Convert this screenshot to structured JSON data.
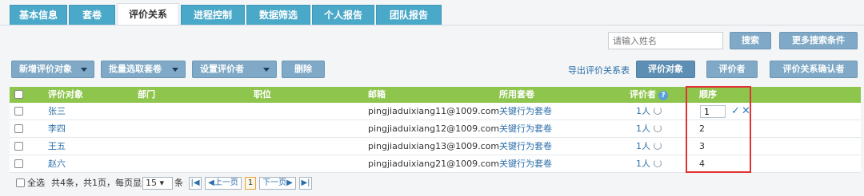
{
  "tabs": [
    {
      "label": "基本信息",
      "active": false
    },
    {
      "label": "套卷",
      "active": false
    },
    {
      "label": "评价关系",
      "active": true
    },
    {
      "label": "进程控制",
      "active": false
    },
    {
      "label": "数据筛选",
      "active": false
    },
    {
      "label": "个人报告",
      "active": false
    },
    {
      "label": "团队报告",
      "active": false
    }
  ],
  "search": {
    "placeholder": "请输入姓名",
    "search_label": "搜索",
    "more_label": "更多搜索条件"
  },
  "toolbar": {
    "add_target_label": "新增评价对象",
    "batch_select_label": "批量选取套卷",
    "set_evaluator_label": "设置评价者",
    "delete_label": "删除",
    "export_link": "导出评价关系表",
    "view_target_label": "评价对象",
    "view_evaluator_label": "评价者",
    "view_confirm_label": "评价关系确认者"
  },
  "table": {
    "headers": {
      "target": "评价对象",
      "dept": "部门",
      "position": "职位",
      "email": "邮箱",
      "suite": "所用套卷",
      "evaluator": "评价者",
      "order": "顺序"
    },
    "rows": [
      {
        "name": "张三",
        "email": "pingjiaduixiang11@1009.com",
        "suite": "关键行为套卷",
        "evaluator": "1人",
        "order": "1",
        "editing": true
      },
      {
        "name": "李四",
        "email": "pingjiaduixiang12@1009.com",
        "suite": "关键行为套卷",
        "evaluator": "1人",
        "order": "2",
        "editing": false
      },
      {
        "name": "王五",
        "email": "pingjiaduixiang13@1009.com",
        "suite": "关键行为套卷",
        "evaluator": "1人",
        "order": "3",
        "editing": false
      },
      {
        "name": "赵六",
        "email": "pingjiaduixiang21@1009.com",
        "suite": "关键行为套卷",
        "evaluator": "1人",
        "order": "4",
        "editing": false
      }
    ]
  },
  "footer": {
    "select_all": "全选",
    "summary": "共4条，共1页，每页显示",
    "page_size": "15",
    "unit": "条",
    "first": "|◀",
    "prev": "◀上一页",
    "current_page": "1",
    "next": "下一页▶",
    "last": "▶|"
  },
  "icons": {
    "help": "question-icon",
    "refresh": "refresh-icon",
    "confirm": "check-icon",
    "cancel": "close-icon"
  },
  "colors": {
    "tab_bg": "#4aa8c8",
    "header_green": "#8ec54d",
    "button_blue": "#7fa9c6",
    "highlight_red": "#e03333",
    "link_blue": "#2d6fa9"
  }
}
